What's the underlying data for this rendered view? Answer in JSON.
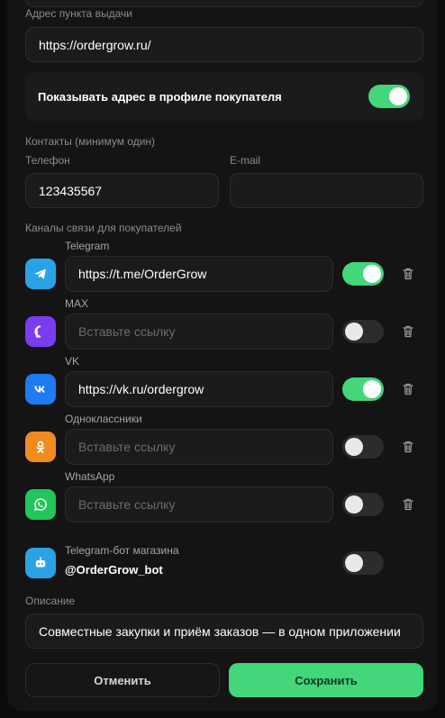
{
  "pickup": {
    "label": "Адрес пункта выдачи",
    "value": "https://ordergrow.ru/"
  },
  "show_address": {
    "label": "Показывать адрес в профиле покупателя",
    "enabled": true
  },
  "contacts": {
    "section_label": "Контакты (минимум один)",
    "phone_label": "Телефон",
    "phone_value": "123435567",
    "email_label": "E-mail",
    "email_value": ""
  },
  "channels": {
    "section_label": "Каналы связи для покупателей",
    "placeholder": "Вставьте ссылку",
    "items": [
      {
        "name": "Telegram",
        "value": "https://t.me/OrderGrow",
        "enabled": true,
        "icon": "telegram-icon",
        "color": "#2aa3e6"
      },
      {
        "name": "MAX",
        "value": "",
        "enabled": false,
        "icon": "max-icon",
        "color": "#7b3cf0"
      },
      {
        "name": "VK",
        "value": "https://vk.ru/ordergrow",
        "enabled": true,
        "icon": "vk-icon",
        "color": "#1f7bf2"
      },
      {
        "name": "Одноклассники",
        "value": "",
        "enabled": false,
        "icon": "odnoklassniki-icon",
        "color": "#f08b1d"
      },
      {
        "name": "WhatsApp",
        "value": "",
        "enabled": false,
        "icon": "whatsapp-icon",
        "color": "#25c45c"
      }
    ]
  },
  "bot": {
    "label": "Telegram-бот магазина",
    "handle": "@OrderGrow_bot",
    "enabled": false,
    "color": "#2aa3e6"
  },
  "description": {
    "label": "Описание",
    "value": "Совместные закупки и приём заказов — в одном приложении"
  },
  "buttons": {
    "cancel": "Отменить",
    "save": "Сохранить"
  },
  "colors": {
    "accent": "#43d67b",
    "panel": "#141414",
    "field": "#1b1b1c"
  }
}
